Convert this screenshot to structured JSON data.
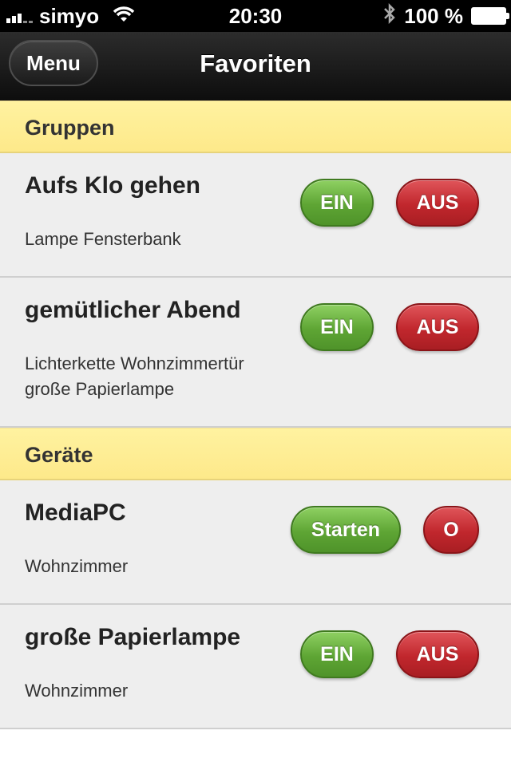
{
  "status_bar": {
    "carrier": "simyo",
    "time": "20:30",
    "battery_percent": "100 %"
  },
  "nav": {
    "menu_label": "Menu",
    "title": "Favoriten"
  },
  "sections": [
    {
      "header": "Gruppen",
      "items": [
        {
          "title": "Aufs Klo gehen",
          "sub": [
            "Lampe Fensterbank"
          ],
          "on_label": "EIN",
          "off_label": "AUS"
        },
        {
          "title": "gemütlicher Abend",
          "sub": [
            "Lichterkette Wohnzimmertür",
            "große Papierlampe"
          ],
          "on_label": "EIN",
          "off_label": "AUS"
        }
      ]
    },
    {
      "header": "Geräte",
      "items": [
        {
          "title": "MediaPC",
          "sub": [
            "Wohnzimmer"
          ],
          "on_label": "Starten",
          "off_label": "O"
        },
        {
          "title": "große Papierlampe",
          "sub": [
            "Wohnzimmer"
          ],
          "on_label": "EIN",
          "off_label": "AUS"
        }
      ]
    }
  ],
  "colors": {
    "section_header": "#fde98a",
    "button_green": "#5ea534",
    "button_red": "#c1272d"
  }
}
